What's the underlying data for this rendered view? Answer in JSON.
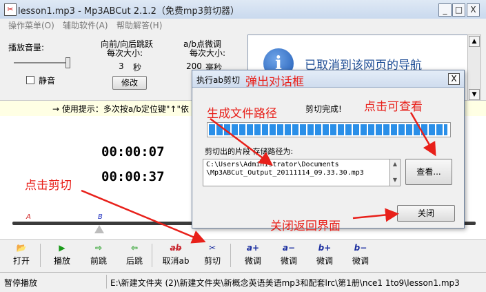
{
  "window": {
    "title": "lesson1.mp3 - Mp3ABCut 2.1.2（免费mp3剪切器）",
    "app_icon": "scissors-app-icon",
    "minimize": "_",
    "maximize": "□",
    "close": "X"
  },
  "menu": [
    "操作菜单(O)",
    "辅助软件(A)",
    "帮助解答(H)"
  ],
  "volume": {
    "label": "播放音量:",
    "mute_label": "静音",
    "muted": false,
    "level": 0.95
  },
  "jump": {
    "title_line1": "向前/向后跳跃",
    "title_line2": "每次大小:",
    "value": "3",
    "unit": "秒",
    "modify": "修改"
  },
  "ab_fine": {
    "title_line1": "a/b点微调",
    "title_line2": "每次大小:",
    "value": "200",
    "unit": "毫秒"
  },
  "browser": {
    "message": "已取消到该网页的导航",
    "icon": "info-icon"
  },
  "hint": "→ 使用提示：多次按a/b定位键\"↑\"依",
  "times": {
    "start": "00:00:07",
    "end": "00:00:37"
  },
  "seek": {
    "a_marker": "A",
    "b_marker": "B"
  },
  "toolbar": [
    {
      "icon": "open-folder-icon",
      "glyph": "📂",
      "label": "打开",
      "color": "#c9a227"
    },
    {
      "icon": "play-icon",
      "glyph": "▶",
      "label": "播放",
      "color": "#1a9a1a"
    },
    {
      "icon": "forward-icon",
      "glyph": "⇨",
      "label": "前跳",
      "color": "#1a9a1a"
    },
    {
      "icon": "backward-icon",
      "glyph": "⇦",
      "label": "后跳",
      "color": "#1a9a1a"
    },
    {
      "icon": "cancel-ab-icon",
      "glyph": "ab",
      "label": "取消ab",
      "color": "#c8232c"
    },
    {
      "icon": "scissors-icon",
      "glyph": "✂",
      "label": "剪切",
      "color": "#1c2fa0"
    },
    {
      "icon": "a-plus-icon",
      "glyph": "a+",
      "label": "微调",
      "color": "#1c2fa0"
    },
    {
      "icon": "a-minus-icon",
      "glyph": "a−",
      "label": "微调",
      "color": "#1c2fa0"
    },
    {
      "icon": "b-plus-icon",
      "glyph": "b+",
      "label": "微调",
      "color": "#1c2fa0"
    },
    {
      "icon": "b-minus-icon",
      "glyph": "b−",
      "label": "微调",
      "color": "#1c2fa0"
    }
  ],
  "status": {
    "state": "暂停播放",
    "path": "E:\\新建文件夹 (2)\\新建文件夹\\新概念英语美语mp3和配套lrc\\第1册\\nce1 1to9\\lesson1.mp3"
  },
  "dialog": {
    "title": "执行ab剪切",
    "close": "X",
    "done": "剪切完成!",
    "progress": 1.0,
    "path_label": "剪切出的片段 存储路径为:",
    "path_line1": "C:\\Users\\Administrator\\Documents",
    "path_line2": "\\Mp3ABCut_Output_20111114_09.33.30.mp3",
    "view_button": "查看...",
    "close_button": "关闭"
  },
  "annotations": {
    "popup": "弹出对话框",
    "gen_path": "生成文件路径",
    "click_view": "点击可查看",
    "click_cut": "点击剪切",
    "close_return": "关闭返回界面",
    "color": "#e8201a"
  }
}
